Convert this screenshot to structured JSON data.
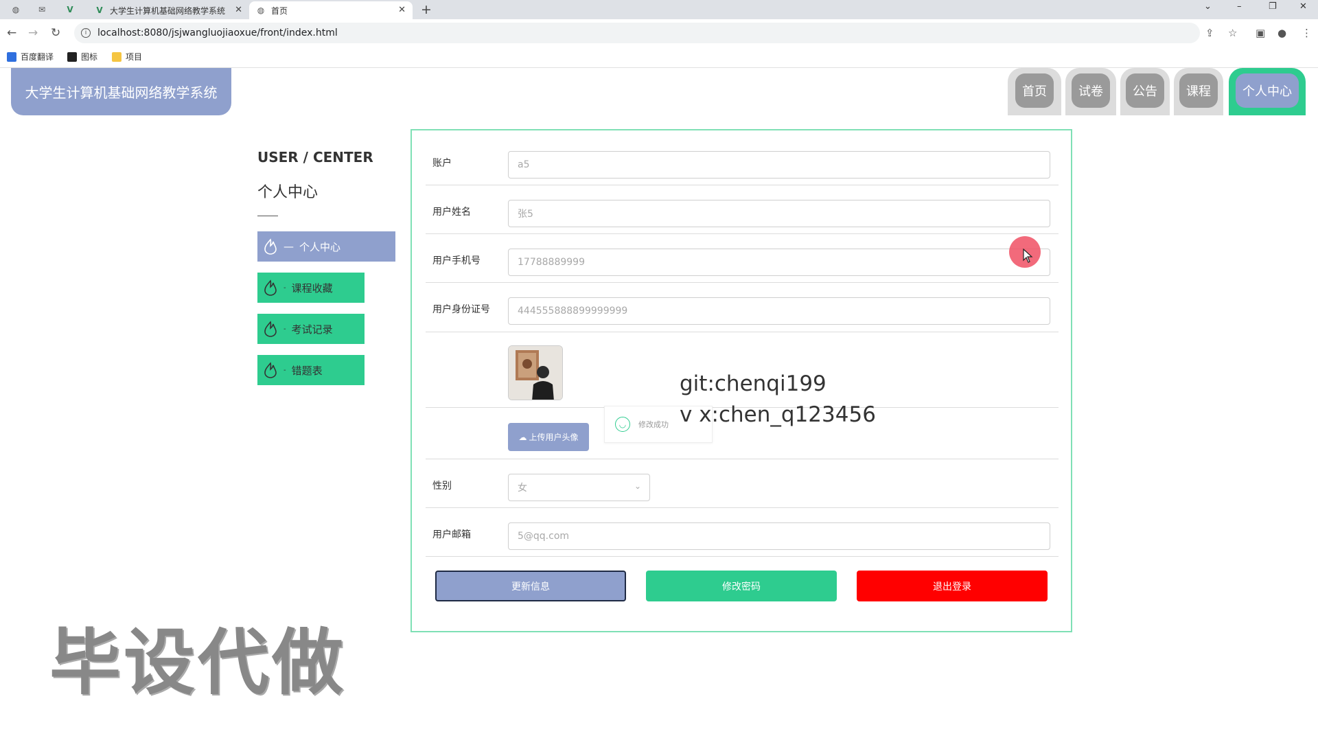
{
  "browser": {
    "tabs": [
      {
        "title": "大学生计算机基础网络教学系统",
        "active": false
      },
      {
        "title": "首页",
        "active": true
      }
    ],
    "url": "localhost:8080/jsjwangluojiaoxue/front/index.html",
    "bookmarks": [
      "百度翻译",
      "图标",
      "项目"
    ]
  },
  "site": {
    "logo_text": "大学生计算机基础网络教学系统",
    "nav": [
      {
        "label": "首页",
        "active": false
      },
      {
        "label": "试卷",
        "active": false
      },
      {
        "label": "公告",
        "active": false
      },
      {
        "label": "课程",
        "active": false
      },
      {
        "label": "个人中心",
        "active": true
      }
    ]
  },
  "sidebar": {
    "title_en": "USER / CENTER",
    "title_cn": "个人中心",
    "items": [
      {
        "label": "个人中心",
        "active": true
      },
      {
        "label": "课程收藏",
        "active": false
      },
      {
        "label": "考试记录",
        "active": false
      },
      {
        "label": "错题表",
        "active": false
      }
    ]
  },
  "form": {
    "account": {
      "label": "账户",
      "value": "a5"
    },
    "name": {
      "label": "用户姓名",
      "value": "张5"
    },
    "phone": {
      "label": "用户手机号",
      "value": "17788889999"
    },
    "id_card": {
      "label": "用户身份证号",
      "value": "444555888899999999"
    },
    "upload_label": "上传用户头像",
    "toast_text": "修改成功",
    "gender": {
      "label": "性别",
      "value": "女"
    },
    "email": {
      "label": "用户邮箱",
      "value": "5@qq.com"
    }
  },
  "actions": {
    "update": "更新信息",
    "change_password": "修改密码",
    "logout": "退出登录"
  },
  "overlay": {
    "git": "git:chenqi199",
    "wx": "v x:chen_q123456",
    "watermark": "毕设代做"
  },
  "colors": {
    "accent_blue": "#8fa0cd",
    "accent_green": "#2ecc8f",
    "danger_red": "#ff0000"
  }
}
